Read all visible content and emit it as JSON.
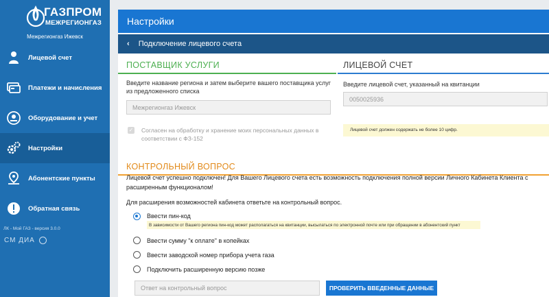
{
  "brand": {
    "title": "ГАЗПРОМ",
    "subtitle": "МЕЖРЕГИОНГАЗ",
    "region": "Межрегионгаз Ижевск"
  },
  "sidebar": {
    "items": [
      {
        "label": "Лицевой счет",
        "icon": "person-icon"
      },
      {
        "label": "Платежи и начисления",
        "icon": "payments-icon"
      },
      {
        "label": "Оборудование и учет",
        "icon": "meter-icon"
      },
      {
        "label": "Настройки",
        "icon": "gear-icon",
        "active": true
      },
      {
        "label": "Абонентские пункты",
        "icon": "location-icon"
      },
      {
        "label": "Обратная связь",
        "icon": "feedback-icon"
      }
    ],
    "version": "ЛК - Мой ГАЗ - версия 3.0.0",
    "footer_logo": "СМ ДИА"
  },
  "header": {
    "title": "Настройки"
  },
  "subheader": {
    "back_icon": "‹",
    "title": "Подключение лицевого счета"
  },
  "provider": {
    "heading": "ПОСТАВЩИК УСЛУГИ",
    "instruction": "Введите название региона и затем выберите вашего поставщика услуг из предложенного списка",
    "value": "Межрегионгаз Ижевск",
    "consent": "Согласен на обработку и хранение моих персональных данных в соответствии с ФЗ-152"
  },
  "account": {
    "heading": "ЛИЦЕВОЙ СЧЕТ",
    "instruction": "Введите лицевой счет, указанный на квитанции",
    "value": "0050025936",
    "hint": "Лицевой счет должен содержать не более 10 цифр."
  },
  "question": {
    "heading": "КОНТРОЛЬНЫЙ ВОПРОС",
    "success_text": "Лицевой счет успешно подключен! Для Вашего Лицевого счета есть возможность подключения полной версии Личного Кабинета Клиента с расширенным функционалом!",
    "prompt": "Для расширения возможностей кабинета ответьте на контрольный вопрос.",
    "options": [
      {
        "label": "Ввести пин-код",
        "checked": true
      },
      {
        "label": "Ввести сумму \"к оплате\" в копейках",
        "checked": false
      },
      {
        "label": "Ввести заводской номер прибора учета газа",
        "checked": false
      },
      {
        "label": "Подключить расширенную версию позже",
        "checked": false
      }
    ],
    "pin_hint": "В зависимости от Вашего региона пин-код может располагаться на квитанции, высылаться по электронной почте или при обращении в абонентский пункт",
    "answer_placeholder": "Ответ на контрольный вопрос",
    "submit_label": "ПРОВЕРИТЬ ВВЕДЕННЫЕ ДАННЫЕ"
  },
  "colors": {
    "sidebar": "#1f6fb2",
    "topbar": "#1976d2",
    "subbar": "#1c5588",
    "green": "#4caf50",
    "orange": "#f0a030",
    "hint": "#fcf8d3"
  }
}
